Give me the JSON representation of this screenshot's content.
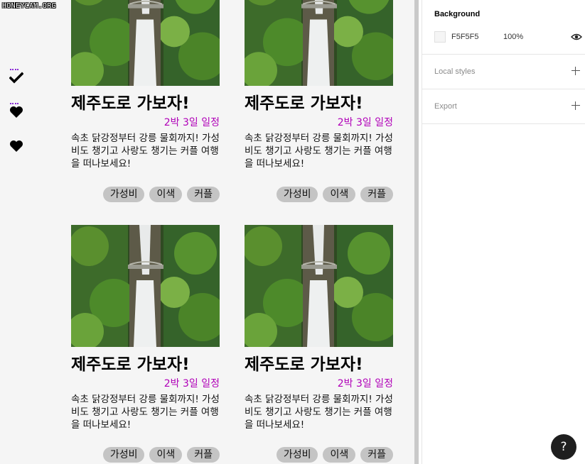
{
  "watermark": "HONEYCAM.ORG",
  "sidebar": {
    "icons": [
      "check-icon",
      "heart-icon",
      "heart-icon"
    ]
  },
  "cards": [
    {
      "title": "제주도로 가보자!",
      "duration": "2박 3일 일정",
      "description": "속초 닭강정부터 강릉 물회까지! 가성비도 챙기고 사랑도 챙기는 커플 여행을 떠나보세요!",
      "tags": [
        "가성비",
        "이색",
        "커플"
      ]
    },
    {
      "title": "제주도로 가보자!",
      "duration": "2박 3일 일정",
      "description": "속초 닭강정부터 강릉 물회까지! 가성비도 챙기고 사랑도 챙기는 커플 여행을 떠나보세요!",
      "tags": [
        "가성비",
        "이색",
        "커플"
      ]
    },
    {
      "title": "제주도로 가보자!",
      "duration": "2박 3일 일정",
      "description": "속초 닭강정부터 강릉 물회까지! 가성비도 챙기고 사랑도 챙기는 커플 여행을 떠나보세요!",
      "tags": [
        "가성비",
        "이색",
        "커플"
      ]
    },
    {
      "title": "제주도로 가보자!",
      "duration": "2박 3일 일정",
      "description": "속초 닭강정부터 강릉 물회까지! 가성비도 챙기고 사랑도 챙기는 커플 여행을 떠나보세요!",
      "tags": [
        "가성비",
        "이색",
        "커플"
      ]
    }
  ],
  "panel": {
    "background": {
      "title": "Background",
      "hex": "F5F5F5",
      "opacity": "100%",
      "swatch_color": "#F5F5F5"
    },
    "local_styles": {
      "title": "Local styles"
    },
    "export": {
      "title": "Export"
    }
  },
  "help": {
    "label": "?"
  },
  "colors": {
    "duration": "#b000b8",
    "tag_bg": "#C4C4C4",
    "canvas_bg": "#F5F5F5"
  }
}
